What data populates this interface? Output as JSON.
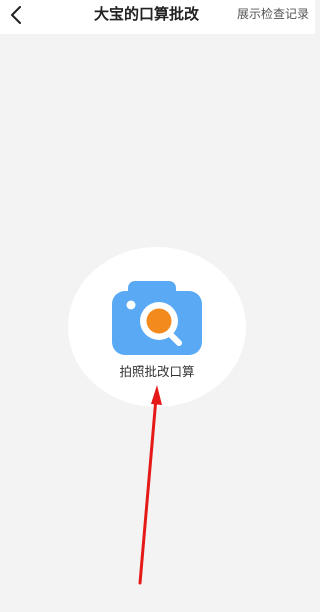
{
  "header": {
    "back_icon": "chevron-left-icon",
    "title": "大宝的口算批改",
    "link_label": "展示检查记录"
  },
  "main": {
    "capture_button_label": "拍照批改口算",
    "capture_icon": "camera-search-icon"
  },
  "colors": {
    "background": "#f3f3f3",
    "camera_blue": "#5aa9f5",
    "lens_orange": "#f28a1e",
    "annotation_red": "#e61919"
  },
  "annotation": {
    "icon": "red-arrow-pointer"
  }
}
